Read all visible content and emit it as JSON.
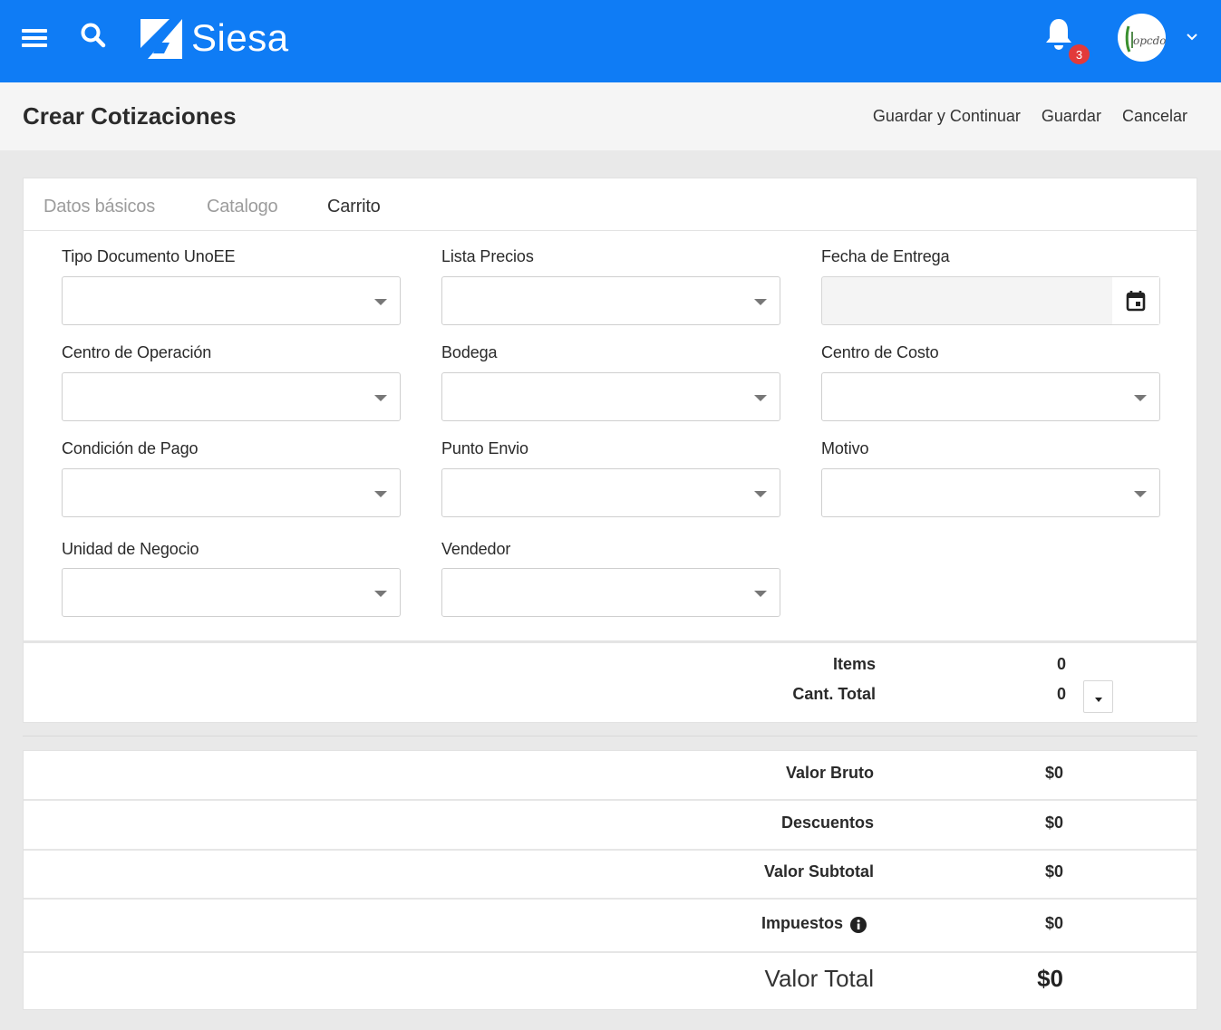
{
  "topbar": {
    "brand": "Siesa",
    "notifications_count": "3",
    "colors": {
      "bar": "#0f7cf5",
      "badge": "#e23a3a"
    }
  },
  "header": {
    "title": "Crear Cotizaciones",
    "actions": {
      "save_continue": "Guardar y Continuar",
      "save": "Guardar",
      "cancel": "Cancelar"
    }
  },
  "tabs": [
    {
      "label": "Datos básicos",
      "active": false
    },
    {
      "label": "Catalogo",
      "active": false
    },
    {
      "label": "Carrito",
      "active": true
    }
  ],
  "form": {
    "tipo_documento": {
      "label": "Tipo Documento UnoEE",
      "value": ""
    },
    "lista_precios": {
      "label": "Lista Precios",
      "value": ""
    },
    "fecha_entrega": {
      "label": "Fecha de Entrega",
      "value": ""
    },
    "centro_operacion": {
      "label": "Centro de Operación",
      "value": ""
    },
    "bodega": {
      "label": "Bodega",
      "value": ""
    },
    "centro_costo": {
      "label": "Centro de Costo",
      "value": ""
    },
    "condicion_pago": {
      "label": "Condición de Pago",
      "value": ""
    },
    "punto_envio": {
      "label": "Punto Envio",
      "value": ""
    },
    "motivo": {
      "label": "Motivo",
      "value": ""
    },
    "unidad_negocio": {
      "label": "Unidad de Negocio",
      "value": ""
    },
    "vendedor": {
      "label": "Vendedor",
      "value": ""
    }
  },
  "summary": {
    "items_label": "Items",
    "items_value": "0",
    "cant_total_label": "Cant. Total",
    "cant_total_value": "0"
  },
  "totals": {
    "valor_bruto": {
      "label": "Valor Bruto",
      "value": "$0"
    },
    "descuentos": {
      "label": "Descuentos",
      "value": "$0"
    },
    "valor_subtotal": {
      "label": "Valor Subtotal",
      "value": "$0"
    },
    "impuestos": {
      "label": "Impuestos",
      "value": "$0"
    },
    "valor_total": {
      "label": "Valor Total",
      "value": "$0"
    }
  }
}
